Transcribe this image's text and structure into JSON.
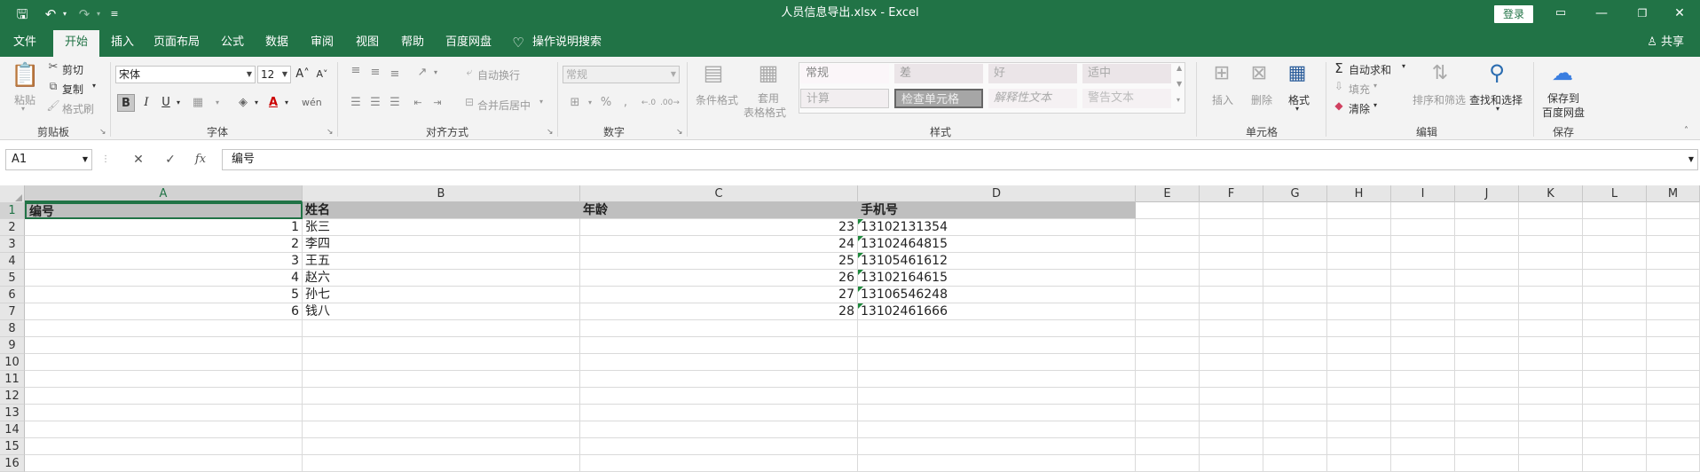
{
  "titlebar": {
    "title": "人员信息导出.xlsx  -  Excel",
    "login": "登录"
  },
  "menu": {
    "tabs": [
      "文件",
      "开始",
      "插入",
      "页面布局",
      "公式",
      "数据",
      "审阅",
      "视图",
      "帮助",
      "百度网盘",
      "操作说明搜索"
    ],
    "active_tab": "开始",
    "share": "共享"
  },
  "ribbon": {
    "clipboard": {
      "paste": "粘贴",
      "cut": "剪切",
      "copy": "复制",
      "format_painter": "格式刷",
      "label": "剪贴板"
    },
    "font": {
      "name": "宋体",
      "size": "12",
      "label": "字体",
      "bold": "B",
      "italic": "I",
      "underline": "U"
    },
    "alignment": {
      "wrap": "自动换行",
      "merge": "合并后居中",
      "label": "对齐方式"
    },
    "number": {
      "format": "常规",
      "label": "数字",
      "percent": "%"
    },
    "styles": {
      "conditional": "条件格式",
      "table_format_1": "套用",
      "table_format_2": "表格格式",
      "cells": [
        "常规",
        "差",
        "好",
        "适中",
        "计算",
        "检查单元格",
        "解释性文本",
        "警告文本"
      ],
      "label": "样式"
    },
    "cells_group": {
      "insert": "插入",
      "delete": "删除",
      "format": "格式",
      "label": "单元格"
    },
    "editing": {
      "autosum": "自动求和",
      "fill": "填充",
      "clear": "清除",
      "sort": "排序和筛选",
      "find": "查找和选择",
      "label": "编辑"
    },
    "save": {
      "line1": "保存到",
      "line2": "百度网盘",
      "label": "保存"
    }
  },
  "formula_bar": {
    "name_box": "A1",
    "formula": "编号",
    "fx": "fx"
  },
  "sheet": {
    "active_cell": "A1",
    "columns": [
      "A",
      "B",
      "C",
      "D",
      "E",
      "F",
      "G",
      "H",
      "I",
      "J",
      "K",
      "L",
      "M"
    ],
    "rows": [
      "1",
      "2",
      "3",
      "4",
      "5",
      "6",
      "7",
      "8",
      "9",
      "10",
      "11",
      "12",
      "13",
      "14",
      "15",
      "16"
    ],
    "headers": [
      "编号",
      "姓名",
      "年龄",
      "手机号"
    ],
    "data": [
      [
        "1",
        "张三",
        "23",
        "13102131354"
      ],
      [
        "2",
        "李四",
        "24",
        "13102464815"
      ],
      [
        "3",
        "王五",
        "25",
        "13105461612"
      ],
      [
        "4",
        "赵六",
        "26",
        "13102164615"
      ],
      [
        "5",
        "孙七",
        "27",
        "13106546248"
      ],
      [
        "6",
        "钱八",
        "28",
        "13102461666"
      ]
    ]
  },
  "colors": {
    "brand": "#217346",
    "header_fill": "#bfbfbf"
  }
}
